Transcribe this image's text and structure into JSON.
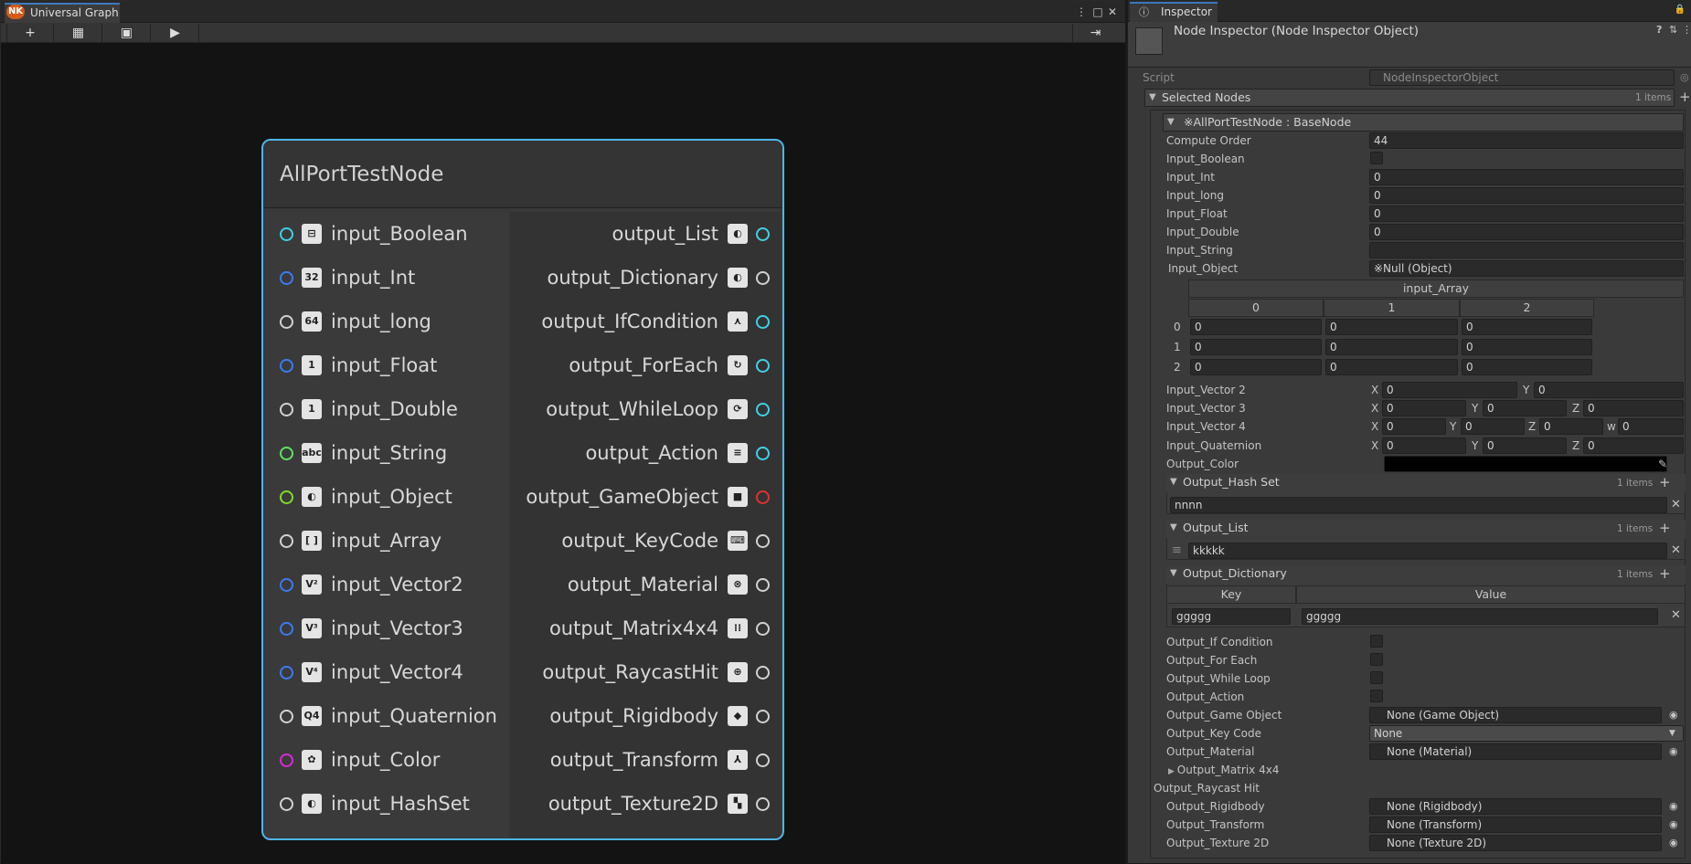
{
  "graph_window": {
    "tab_title": "Universal Graph",
    "logo_text": "NK",
    "menu_glyph": "⋮",
    "maximize_glyph": "□",
    "close_glyph": "✕",
    "toolbar": {
      "add": "+",
      "table": "▦",
      "frame": "▣",
      "play": "▶",
      "exit": "⇥"
    }
  },
  "node": {
    "title": "AllPortTestNode",
    "inputs": [
      {
        "label": "input_Boolean",
        "port_color": "#3ed1e6",
        "icon": "toggle-icon",
        "glyph": "⊟"
      },
      {
        "label": "input_Int",
        "port_color": "#3b7bf2",
        "icon": "int32-icon",
        "glyph": "32"
      },
      {
        "label": "input_long",
        "port_color": "#d2d2d2",
        "icon": "int64-icon",
        "glyph": "64"
      },
      {
        "label": "input_Float",
        "port_color": "#3b7bf2",
        "icon": "float-icon",
        "glyph": "1"
      },
      {
        "label": "input_Double",
        "port_color": "#d2d2d2",
        "icon": "double-icon",
        "glyph": "1"
      },
      {
        "label": "input_String",
        "port_color": "#5fe25f",
        "icon": "string-icon",
        "glyph": "abc"
      },
      {
        "label": "input_Object",
        "port_color": "#7fdc2a",
        "icon": "object-icon",
        "glyph": "◐"
      },
      {
        "label": "input_Array",
        "port_color": "#d2d2d2",
        "icon": "array-icon",
        "glyph": "[ ]"
      },
      {
        "label": "input_Vector2",
        "port_color": "#3b7bf2",
        "icon": "vector2-icon",
        "glyph": "V²"
      },
      {
        "label": "input_Vector3",
        "port_color": "#3b7bf2",
        "icon": "vector3-icon",
        "glyph": "V³"
      },
      {
        "label": "input_Vector4",
        "port_color": "#3b7bf2",
        "icon": "vector4-icon",
        "glyph": "V⁴"
      },
      {
        "label": "input_Quaternion",
        "port_color": "#d2d2d2",
        "icon": "quaternion-icon",
        "glyph": "Q4"
      },
      {
        "label": "input_Color",
        "port_color": "#d62ad6",
        "icon": "palette-icon",
        "glyph": "✿"
      },
      {
        "label": "input_HashSet",
        "port_color": "#d2d2d2",
        "icon": "hashset-icon",
        "glyph": "◐"
      }
    ],
    "outputs": [
      {
        "label": "output_List",
        "port_color": "#3ed1e6",
        "icon": "list-icon",
        "glyph": "◐"
      },
      {
        "label": "output_Dictionary",
        "port_color": "#d2d2d2",
        "icon": "dictionary-icon",
        "glyph": "◐"
      },
      {
        "label": "output_IfCondition",
        "port_color": "#3ed1e6",
        "icon": "branch-icon",
        "glyph": "⋏"
      },
      {
        "label": "output_ForEach",
        "port_color": "#3ed1e6",
        "icon": "foreach-icon",
        "glyph": "↻"
      },
      {
        "label": "output_WhileLoop",
        "port_color": "#3ed1e6",
        "icon": "loop-icon",
        "glyph": "⟳"
      },
      {
        "label": "output_Action",
        "port_color": "#3ed1e6",
        "icon": "action-icon",
        "glyph": "≡"
      },
      {
        "label": "output_GameObject",
        "port_color": "#e03030",
        "icon": "cube-icon",
        "glyph": "■"
      },
      {
        "label": "output_KeyCode",
        "port_color": "#d2d2d2",
        "icon": "keyboard-icon",
        "glyph": "⌨"
      },
      {
        "label": "output_Material",
        "port_color": "#d2d2d2",
        "icon": "material-icon",
        "glyph": "⊗"
      },
      {
        "label": "output_Matrix4x4",
        "port_color": "#d2d2d2",
        "icon": "matrix-icon",
        "glyph": "⁞⁞"
      },
      {
        "label": "output_RaycastHit",
        "port_color": "#d2d2d2",
        "icon": "crosshair-icon",
        "glyph": "⊕"
      },
      {
        "label": "output_Rigidbody",
        "port_color": "#d2d2d2",
        "icon": "rigidbody-icon",
        "glyph": "◆"
      },
      {
        "label": "output_Transform",
        "port_color": "#d2d2d2",
        "icon": "transform-icon",
        "glyph": "⅄"
      },
      {
        "label": "output_Texture2D",
        "port_color": "#d2d2d2",
        "icon": "texture-icon",
        "glyph": "▚"
      }
    ]
  },
  "inspector": {
    "tab_title": "Inspector",
    "header_title": "Node Inspector (Node Inspector Object)",
    "help_glyph": "?",
    "settings_glyph": "⇅",
    "menu_glyph": "⋮",
    "lock_glyph": "🔒",
    "script_label": "Script",
    "script_value": "NodeInspectorObject",
    "selected_nodes": {
      "label": "Selected Nodes",
      "count": "1 items"
    },
    "element_label": "※AllPortTestNode : BaseNode",
    "fields": {
      "compute_order": {
        "label": "Compute Order",
        "value": "44"
      },
      "input_boolean": {
        "label": "Input_Boolean"
      },
      "input_int": {
        "label": "Input_Int",
        "value": "0"
      },
      "input_long": {
        "label": "Input_long",
        "value": "0"
      },
      "input_float": {
        "label": "Input_Float",
        "value": "0"
      },
      "input_double": {
        "label": "Input_Double",
        "value": "0"
      },
      "input_string": {
        "label": "Input_String",
        "value": ""
      },
      "input_object": {
        "label": "Input_Object",
        "value": "※Null (Object)"
      }
    },
    "input_array": {
      "title": "input_Array",
      "columns": [
        "0",
        "1",
        "2"
      ],
      "rows": [
        {
          "index": "0",
          "cells": [
            "0",
            "0",
            "0"
          ]
        },
        {
          "index": "1",
          "cells": [
            "0",
            "0",
            "0"
          ]
        },
        {
          "index": "2",
          "cells": [
            "0",
            "0",
            "0"
          ]
        }
      ]
    },
    "vectors": {
      "v2": {
        "label": "Input_Vector 2",
        "x": "0",
        "y": "0"
      },
      "v3": {
        "label": "Input_Vector 3",
        "x": "0",
        "y": "0",
        "z": "0"
      },
      "v4": {
        "label": "Input_Vector 4",
        "x": "0",
        "y": "0",
        "z": "0",
        "w": "0"
      },
      "quat": {
        "label": "Input_Quaternion",
        "x": "0",
        "y": "0",
        "z": "0"
      },
      "axis_labels": {
        "x": "X",
        "y": "Y",
        "z": "Z",
        "w": "w"
      }
    },
    "output_color": {
      "label": "Output_Color",
      "swatch": "#000000"
    },
    "hash_set": {
      "label": "Output_Hash Set",
      "count": "1 items",
      "item": "nnnn"
    },
    "list": {
      "label": "Output_List",
      "count": "1 items",
      "item": "kkkkk"
    },
    "dictionary": {
      "label": "Output_Dictionary",
      "count": "1 items",
      "key_header": "Key",
      "value_header": "Value",
      "key": "ggggg",
      "value": "ggggg"
    },
    "checks": {
      "if": "Output_If Condition",
      "foreach": "Output_For Each",
      "while": "Output_While Loop",
      "action": "Output_Action"
    },
    "objects": {
      "game_object": {
        "label": "Output_Game Object",
        "value": "None (Game Object)"
      },
      "key_code": {
        "label": "Output_Key Code",
        "value": "None"
      },
      "material": {
        "label": "Output_Material",
        "value": "None (Material)"
      },
      "matrix": {
        "label": "Output_Matrix 4x4"
      },
      "raycast": {
        "label": "Output_Raycast Hit"
      },
      "rigidbody": {
        "label": "Output_Rigidbody",
        "value": "None (Rigidbody)"
      },
      "transform": {
        "label": "Output_Transform",
        "value": "None (Transform)"
      },
      "texture": {
        "label": "Output_Texture 2D",
        "value": "None (Texture 2D)"
      }
    }
  }
}
